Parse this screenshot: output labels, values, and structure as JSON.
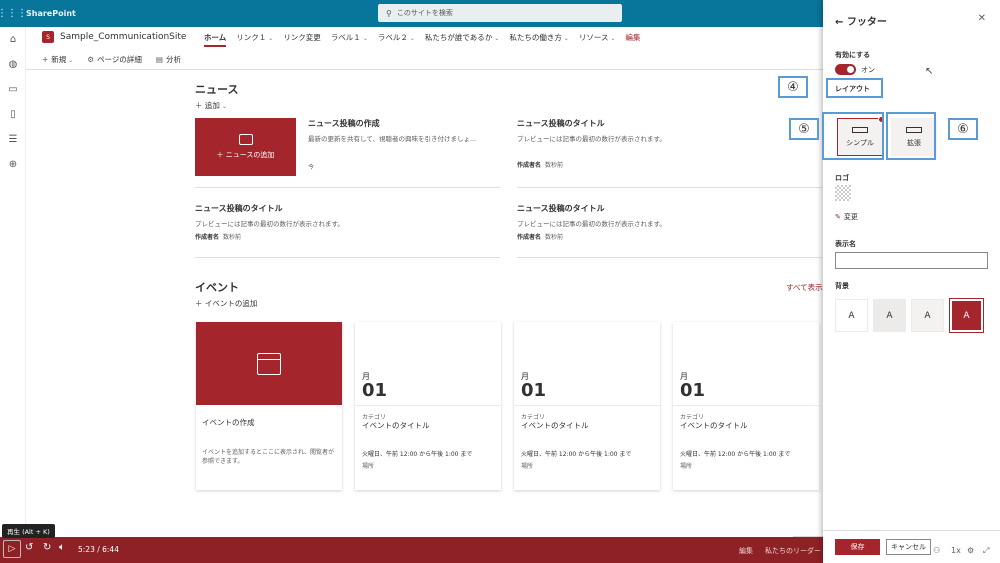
{
  "suite": {
    "app_name": "SharePoint",
    "search_placeholder": "このサイトを検索"
  },
  "site": {
    "logo_letter": "S",
    "name": "Sample_CommunicationSite",
    "nav": [
      {
        "label": "ホーム",
        "dropdown": false
      },
      {
        "label": "リンク１",
        "dropdown": true
      },
      {
        "label": "リンク変更",
        "dropdown": false
      },
      {
        "label": "ラベル１",
        "dropdown": true
      },
      {
        "label": "ラベル２",
        "dropdown": true
      },
      {
        "label": "私たちが誰であるか",
        "dropdown": true
      },
      {
        "label": "私たちの働き方",
        "dropdown": true
      },
      {
        "label": "リソース",
        "dropdown": true
      },
      {
        "label": "編集",
        "dropdown": false
      }
    ],
    "commands": {
      "new": "新規",
      "page_details": "ページの詳細",
      "analytics": "分析"
    }
  },
  "news": {
    "title": "ニュース",
    "add": "追加",
    "hero_label": "ニュースの追加",
    "cards": [
      {
        "title": "ニュース投稿の作成",
        "desc": "最新の更新を共有して、視聴者の興味を引き付けましょ...",
        "time": "今"
      },
      {
        "title": "ニュース投稿のタイトル",
        "desc": "プレビューには記事の最初の数行が表示されます。",
        "author": "作成者名",
        "ago": "数秒前"
      },
      {
        "title": "ニュース投稿のタイトル",
        "desc": "プレビューには記事の最初の数行が表示されます。",
        "author": "作成者名",
        "ago": "数秒前"
      },
      {
        "title": "ニュース投稿のタイトル",
        "desc": "プレビューには記事の最初の数行が表示されます。",
        "author": "作成者名",
        "ago": "数秒前"
      }
    ]
  },
  "events": {
    "title": "イベント",
    "add": "イベントの追加",
    "see_all": "すべて表示",
    "create": {
      "title": "イベントの作成",
      "desc": "イベントを追加するとここに表示され、閲覧者が参照できます。"
    },
    "cards": [
      {
        "month": "月",
        "day": "01",
        "category": "カテゴリ",
        "title": "イベントのタイトル",
        "when": "火曜日、午前 12:00 から午後 1:00 まで",
        "location": "場所"
      },
      {
        "month": "月",
        "day": "01",
        "category": "カテゴリ",
        "title": "イベントのタイトル",
        "when": "火曜日、午前 12:00 から午後 1:00 まで",
        "location": "場所"
      },
      {
        "month": "月",
        "day": "01",
        "category": "カテゴリ",
        "title": "イベントのタイトル",
        "when": "火曜日、午前 12:00 から午後 1:00 まで",
        "location": "場所"
      }
    ]
  },
  "player": {
    "tooltip": "再生 (Alt + K)",
    "time": "5:23 / 6:44",
    "progress": 0.79,
    "right_items": [
      "編集",
      "私たちのリーダー"
    ],
    "speed": "1x"
  },
  "pane": {
    "title": "フッター",
    "enabled_label": "有効にする",
    "toggle_state": "オン",
    "layout_label": "レイアウト",
    "layout_options": [
      "シンプル",
      "拡張"
    ],
    "selected_layout": "シンプル",
    "logo_label": "ロゴ",
    "change_label": "変更",
    "display_name_label": "表示名",
    "display_name_value": "",
    "background_label": "背景",
    "save": "保存",
    "cancel": "キャンセル"
  },
  "callouts": [
    "④",
    "⑤",
    "⑥"
  ],
  "colors": {
    "suite": "#08759a",
    "accent": "#a4262c",
    "player": "#8e2126",
    "callout": "#5b9bd5"
  }
}
